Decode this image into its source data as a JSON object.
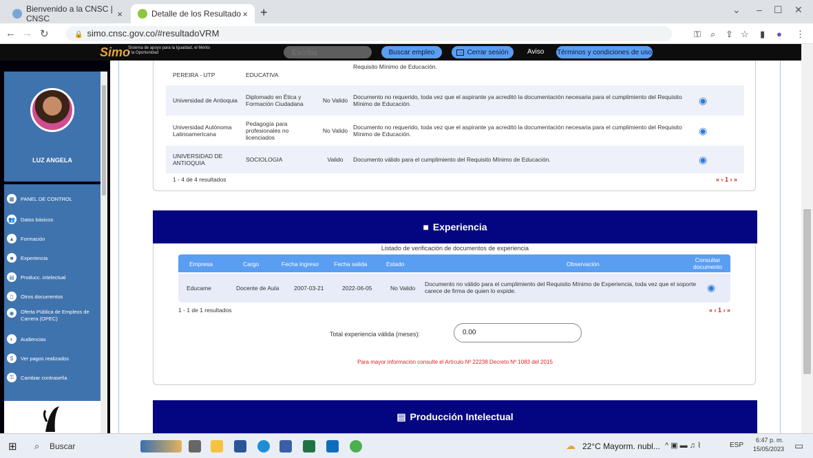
{
  "browser": {
    "tabs": [
      {
        "title": "Bienvenido a la CNSC | CNSC",
        "close": "×"
      },
      {
        "title": "Detalle de los Resultados de la p",
        "close": "×"
      }
    ],
    "new_tab": "+",
    "url": "simo.cnsc.gov.co/#resultadoVRM",
    "window_controls": [
      "⌄",
      "–",
      "☐",
      "✕"
    ]
  },
  "site_header": {
    "logo": "Simo",
    "logo_subtitle": "Sistema de apoyo para la Igualdad, el Mérito y la Oportunidad",
    "search_placeholder": "Escriba",
    "buttons": [
      "Buscar empleo",
      "Cerrar sesión",
      "Aviso",
      "Términos y condiciones de uso"
    ]
  },
  "sidebar": {
    "user_name": "LUZ ANGELA",
    "items": [
      {
        "label": "PANEL DE CONTROL",
        "icon": "dashboard-icon"
      },
      {
        "label": "Datos básicos",
        "icon": "users-icon"
      },
      {
        "label": "Formación",
        "icon": "graduation-cap-icon"
      },
      {
        "label": "Experiencia",
        "icon": "briefcase-icon"
      },
      {
        "label": "Producc. intelectual",
        "icon": "book-icon"
      },
      {
        "label": "Otros documentos",
        "icon": "file-icon"
      },
      {
        "label": "Oferta Pública de Empleos de Carrera (OPEC)",
        "icon": "globe-icon"
      },
      {
        "label": "Audiencias",
        "icon": "audience-icon"
      },
      {
        "label": "Ver pagos realizados",
        "icon": "dollar-icon"
      },
      {
        "label": "Cambiar contraseña",
        "icon": "lock-icon"
      }
    ]
  },
  "formacion": {
    "rows": [
      {
        "institucion": "PEREIRA - UTP",
        "programa": "EDUCATIVA",
        "estado": "",
        "observacion": "Requisito Mínimo de Educación."
      },
      {
        "institucion": "Universidad de Antioquia",
        "programa": "Diplomado en Ética y Formación Ciudadana",
        "estado": "No Valido",
        "observacion": "Documento no requerido, toda vez que el aspirante ya acreditó la documentación necesaria para el cumplimiento del Requisito Mínimo de Educación."
      },
      {
        "institucion": "Universidad Autónoma Latinoamericana",
        "programa": "Pedagogía para profesionales no licenciados",
        "estado": "No Valido",
        "observacion": "Documento no requerido, toda vez que el aspirante ya acreditó la documentación necesaria para el cumplimiento del Requisito Mínimo de Educación."
      },
      {
        "institucion": "UNIVERSIDAD DE ANTIOQUIA",
        "programa": "SOCIOLOGIA",
        "estado": "Valido",
        "observacion": "Documento válido para el cumplimiento del Requisito Mínimo de Educación."
      }
    ],
    "results": "1 - 4 de 4 resultados",
    "pager": "« ‹ 1 › »"
  },
  "experiencia": {
    "title": "Experiencia",
    "subtitle": "Listado de verificación de documentos de experiencia",
    "headers": [
      "Empresa",
      "Cargo",
      "Fecha ingreso",
      "Fecha salida",
      "Estado",
      "Observación",
      "Consultar documento"
    ],
    "rows": [
      {
        "empresa": "Educame",
        "cargo": "Docente de Aula",
        "ingreso": "2007-03-21",
        "salida": "2022-06-05",
        "estado": "No Valido",
        "observacion": "Documento no válido para el cumplimiento del Requisito Mínimo de Experiencia, toda vez que el soporte carece de firma de quien lo expide."
      }
    ],
    "results": "1 - 1 de 1 resultados",
    "pager": "« ‹ 1 › »",
    "total_label": "Total experiencia válida (meses):",
    "total_value": "0.00",
    "note": "Para mayor información consulte el Artículo Nº 22238 Decreto Nº 1083 del 2015"
  },
  "produccion": {
    "title": "Producción Intelectual"
  },
  "taskbar": {
    "search": "Buscar",
    "weather": "22°C Mayorm. nubl...",
    "lang": "ESP",
    "time": "6:47 p. m.",
    "date": "15/05/2023"
  }
}
